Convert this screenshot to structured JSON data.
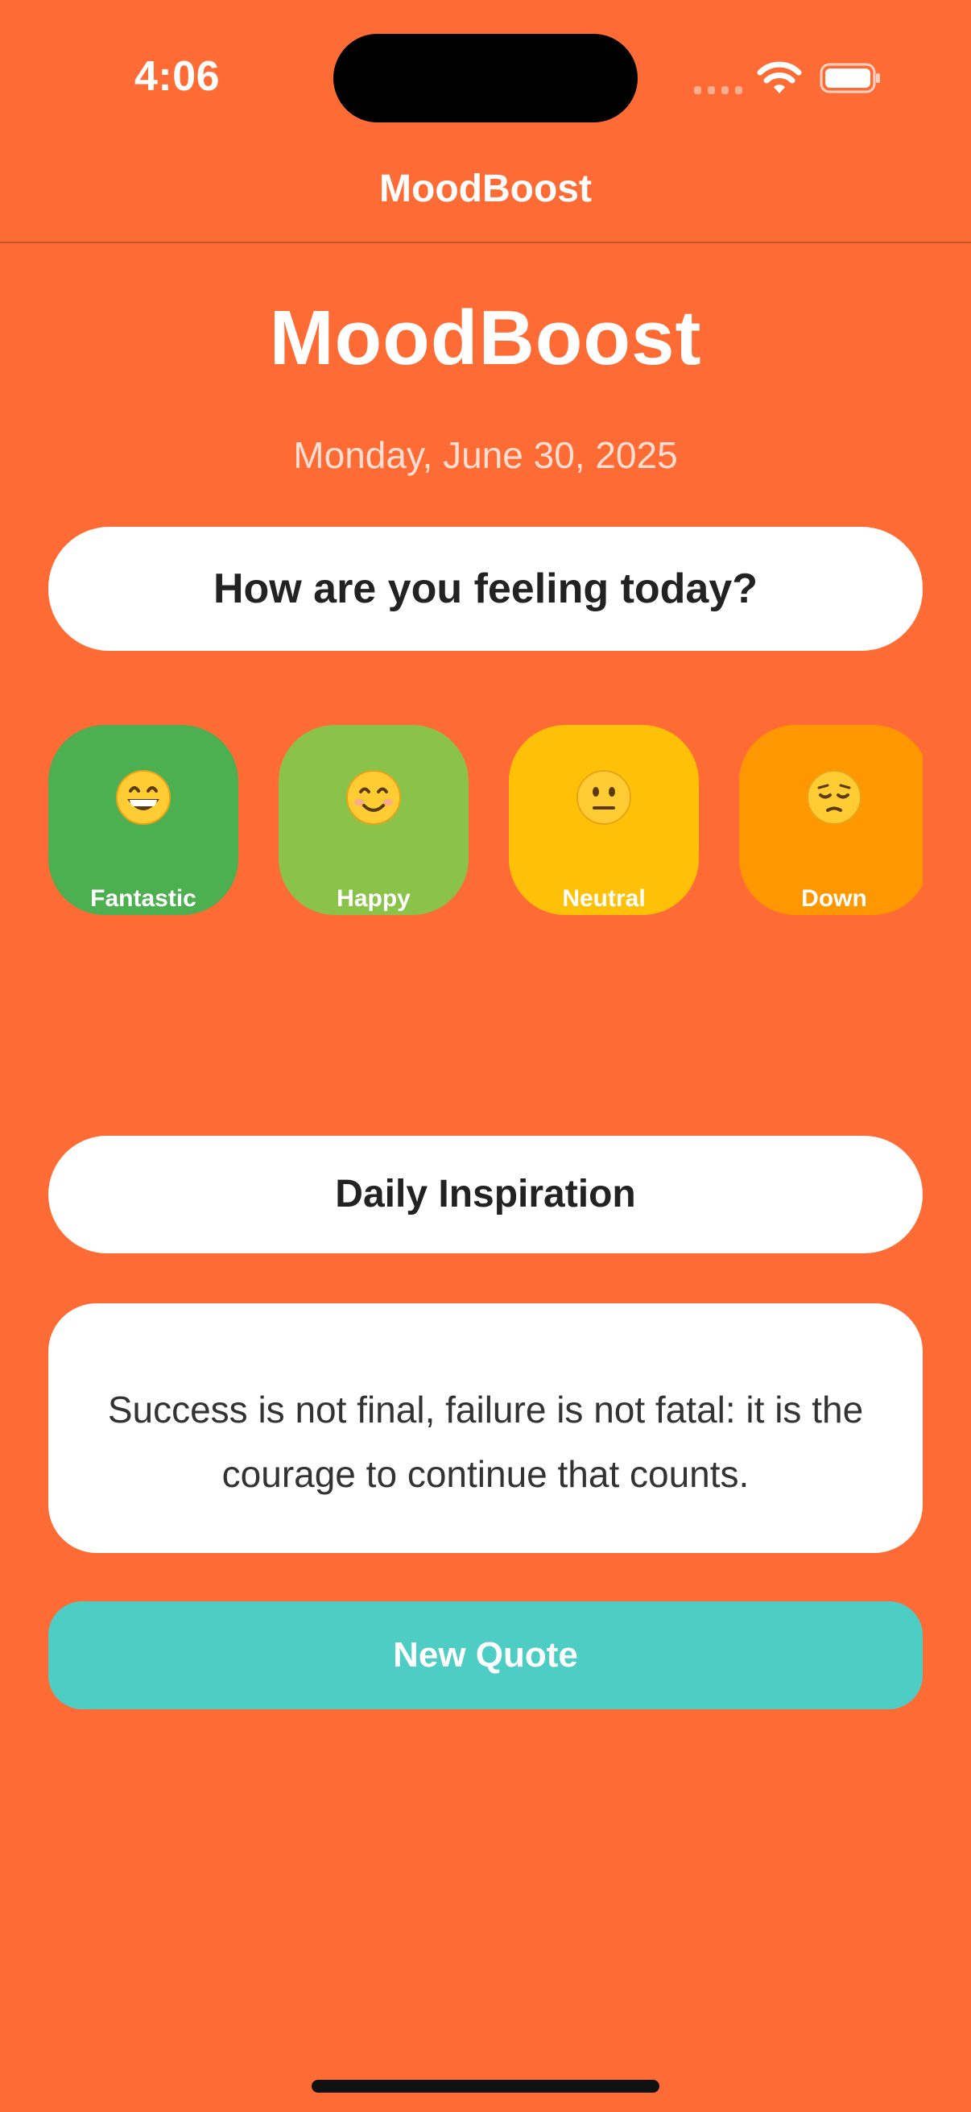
{
  "status_bar": {
    "time": "4:06"
  },
  "nav": {
    "title": "MoodBoost"
  },
  "header": {
    "title": "MoodBoost",
    "date": "Monday, June 30, 2025"
  },
  "mood_prompt": "How are you feeling today?",
  "moods": [
    {
      "label": "Fantastic",
      "icon": "grinning-face-icon",
      "color": "#4CAF50"
    },
    {
      "label": "Happy",
      "icon": "smiling-face-icon",
      "color": "#8BC34A"
    },
    {
      "label": "Neutral",
      "icon": "neutral-face-icon",
      "color": "#FFC107"
    },
    {
      "label": "Down",
      "icon": "pensive-face-icon",
      "color": "#FF9800"
    }
  ],
  "inspiration": {
    "heading": "Daily Inspiration",
    "quote": "Success is not final, failure is not fatal: it is the courage to continue that counts.",
    "button_label": "New Quote"
  },
  "colors": {
    "background": "#FF6B35",
    "accent": "#4ECDC4",
    "card": "#FFFFFF"
  }
}
